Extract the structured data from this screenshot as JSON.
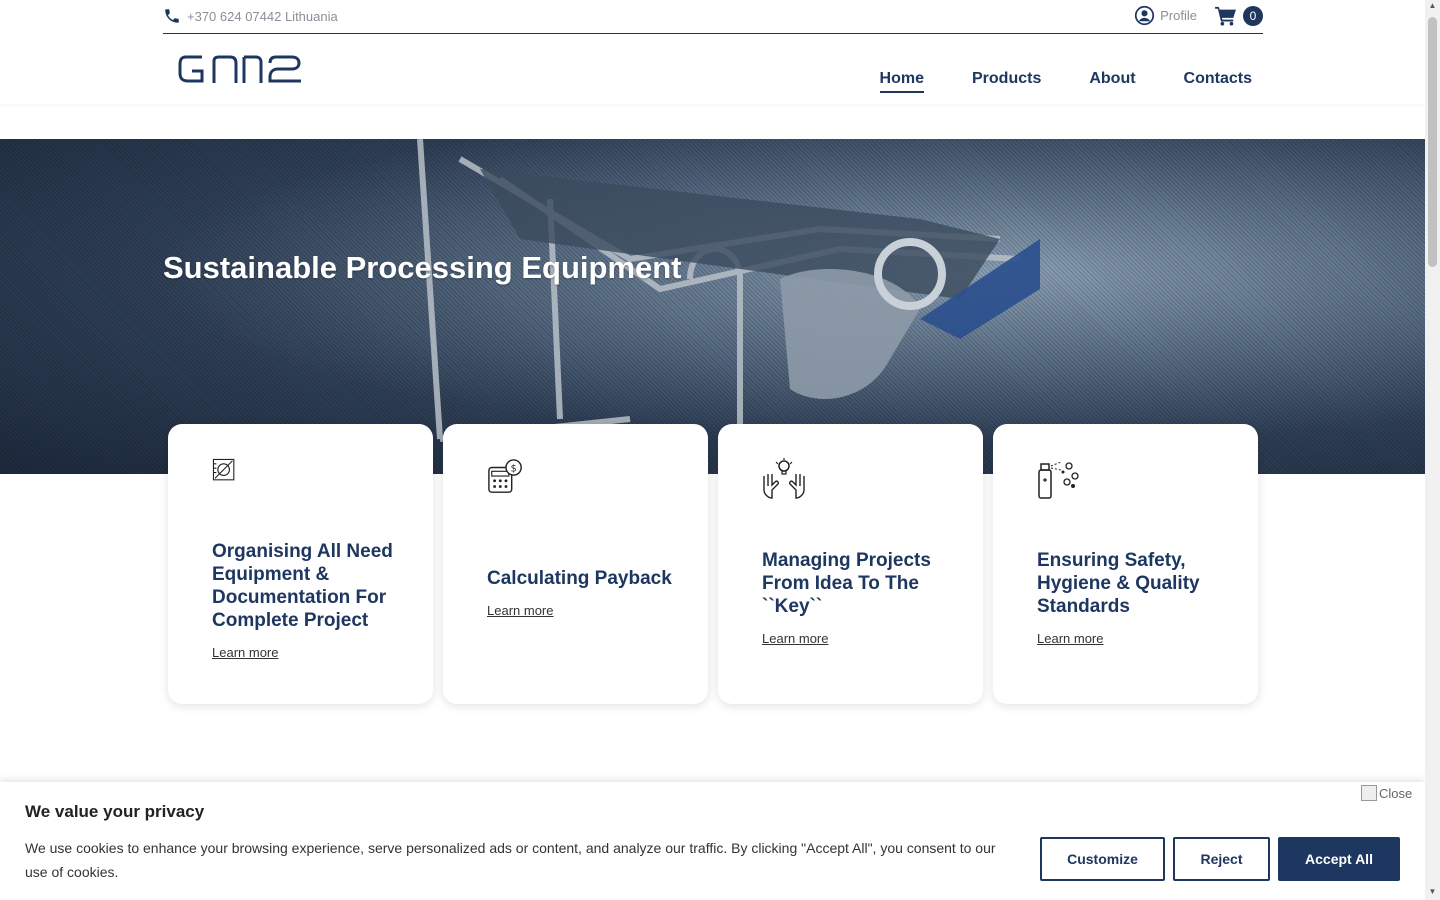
{
  "topbar": {
    "phone_text": "+370 624 07442 Lithuania",
    "profile_label": "Profile",
    "cart_count": "0"
  },
  "header": {
    "logo_alt": "GN2",
    "nav": [
      {
        "label": "Home",
        "active": true
      },
      {
        "label": "Products",
        "active": false
      },
      {
        "label": "About",
        "active": false
      },
      {
        "label": "Contacts",
        "active": false
      }
    ]
  },
  "hero": {
    "title": "Sustainable Processing Equipment"
  },
  "cards": [
    {
      "icon": "drawing-document-icon",
      "title": "Organising All Need Equipment & Documentation For Complete Project",
      "link": "Learn more"
    },
    {
      "icon": "calculator-dollar-icon",
      "title": "Calculating Payback",
      "link": "Learn more"
    },
    {
      "icon": "hands-lightbulb-icon",
      "title": "Managing Projects From Idea To The ``Key``",
      "link": "Learn more"
    },
    {
      "icon": "spray-bottle-icon",
      "title": "Ensuring Safety, Hygiene & Quality Standards",
      "link": "Learn more"
    }
  ],
  "cookie": {
    "title": "We value your privacy",
    "text": "We use cookies to enhance your browsing experience, serve personalized ads or content, and analyze our traffic. By clicking \"Accept All\", you consent to our use of cookies.",
    "close_label": "Close",
    "customize_label": "Customize",
    "reject_label": "Reject",
    "accept_label": "Accept All"
  },
  "colors": {
    "brand": "#1e3760",
    "muted": "#8a8f99"
  }
}
